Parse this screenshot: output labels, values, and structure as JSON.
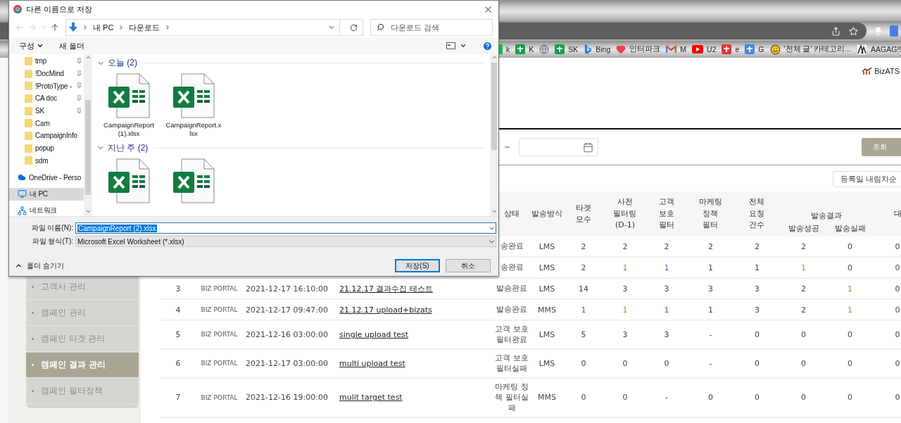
{
  "browser": {
    "bookmarks": [
      {
        "kind": "naver",
        "label": "k"
      },
      {
        "kind": "plus",
        "label": "K"
      },
      {
        "kind": "globe"
      },
      {
        "kind": "plus",
        "label": "SK"
      },
      {
        "kind": "bing",
        "label": "Bing"
      },
      {
        "kind": "heart",
        "label": "인터파크"
      },
      {
        "kind": "mail",
        "label": "M"
      },
      {
        "kind": "video",
        "label": "U2"
      },
      {
        "kind": "red",
        "label": "e"
      },
      {
        "kind": "translate",
        "label": "G"
      },
      {
        "kind": "smile",
        "label": "'전체 글' 카테고리..."
      },
      {
        "kind": "aagag",
        "label": "AAGAG!!"
      }
    ]
  },
  "page": {
    "logo": "BizATS",
    "range_sep": "~",
    "search_button": "조회",
    "sort_button": "등록일 내림차순",
    "sidebar": [
      {
        "label": "고객사 관리",
        "selected": false
      },
      {
        "label": "캠페인 관리",
        "selected": false
      },
      {
        "label": "캠페인 타겟 관리",
        "selected": false
      },
      {
        "label": "캠페인 결과 관리",
        "selected": true
      },
      {
        "label": "캠페인 필터정책",
        "selected": false
      }
    ],
    "table": {
      "columns": [
        {
          "label": "상태"
        },
        {
          "label": "발송방식"
        },
        {
          "label": "타겟 모수"
        },
        {
          "label": "사전 필터링 (D-1)"
        },
        {
          "label": "고객 보호 필터"
        },
        {
          "label": "마케팅 정책 필터"
        },
        {
          "label": "전체 요청 건수"
        },
        {
          "label": "발송결과",
          "children": [
            {
              "label": "발송성공"
            },
            {
              "label": "발송실패"
            }
          ]
        },
        {
          "label": "대"
        }
      ],
      "rows": [
        {
          "status": "송완료",
          "method": "LMS",
          "values": [
            "2",
            "2",
            "2",
            "2",
            "2",
            "2",
            "0",
            "0"
          ]
        },
        {
          "status": "송완료",
          "method": "LMS",
          "values": [
            "2",
            {
              "text": "1",
              "color": "#b8843f"
            },
            {
              "text": "1",
              "color": "#3b6fb0"
            },
            "1",
            "1",
            {
              "text": "1",
              "color": "#b8843f"
            },
            "0",
            "0"
          ]
        },
        {
          "no": "3",
          "channel": "BIZ PORTAL",
          "date": "2021-12-17 16:10:00",
          "title": "21.12.17 결과수집 테스트",
          "status": "발송완료",
          "method": "LMS",
          "values": [
            "14",
            "3",
            "3",
            "3",
            "3",
            "2",
            {
              "text": "1",
              "color": "#b8843f"
            },
            "0"
          ]
        },
        {
          "no": "4",
          "channel": "BIZ PORTAL",
          "date": "2021-12-17 09:47:00",
          "title": "21.12.17 upload+bizats",
          "status": "발송완료",
          "method": "MMS",
          "values": [
            {
              "text": "1",
              "color": "#3b6fb0"
            },
            {
              "text": "1",
              "color": "#b8843f"
            },
            {
              "text": "1",
              "color": "#3b6fb0"
            },
            "1",
            "3",
            "2",
            {
              "text": "1",
              "color": "#b8843f"
            },
            "0"
          ]
        },
        {
          "no": "5",
          "channel": "BIZ PORTAL",
          "date": "2021-12-16 03:00:00",
          "title": "single upload test",
          "status": "고객 보호 필터완료",
          "method": "LMS",
          "values": [
            "5",
            "3",
            "3",
            "-",
            "0",
            "0",
            "0",
            "0"
          ]
        },
        {
          "no": "6",
          "channel": "BIZ PORTAL",
          "date": "2021-12-17 03:00:00",
          "title": "multi upload test",
          "status": "고객 보호 필터실패",
          "method": "LMS",
          "values": [
            "0",
            "0",
            "0",
            "-",
            "0",
            "0",
            "0",
            "0"
          ]
        },
        {
          "no": "7",
          "channel": "BIZ PORTAL",
          "date": "2021-12-16 19:00:00",
          "title": "mulit target test",
          "status": "마케팅 정책 필터실패",
          "method": "MMS",
          "values": [
            "0",
            "0",
            "-",
            "0",
            "0",
            "0",
            "0",
            "0"
          ]
        }
      ]
    }
  },
  "dialog": {
    "title": "다른 이름으로 저장",
    "path": [
      "내 PC",
      "다운로드"
    ],
    "search": {
      "placeholder": "다운로드 검색"
    },
    "organize": "구성",
    "new_folder": "새 폴더",
    "nav_items": [
      {
        "label": "tmp",
        "kind": "folder",
        "pinned": true,
        "selected": false
      },
      {
        "label": "!DocMind",
        "kind": "folder",
        "pinned": true,
        "selected": false
      },
      {
        "label": "!ProtoType -",
        "kind": "folder",
        "pinned": true,
        "selected": false
      },
      {
        "label": "CA doc",
        "kind": "folder",
        "pinned": true,
        "selected": false
      },
      {
        "label": "SK",
        "kind": "folder",
        "pinned": true,
        "selected": false
      },
      {
        "label": "Cam",
        "kind": "folder",
        "pinned": false,
        "selected": false
      },
      {
        "label": "CampaignInfo",
        "kind": "folder",
        "pinned": false,
        "selected": false
      },
      {
        "label": "popup",
        "kind": "folder",
        "pinned": false,
        "selected": false
      },
      {
        "label": "sdm",
        "kind": "folder",
        "pinned": false,
        "selected": false
      },
      {
        "label": "OneDrive - Perso",
        "kind": "cloud",
        "pinned": false,
        "selected": false
      },
      {
        "label": "내 PC",
        "kind": "pc",
        "pinned": false,
        "selected": true
      },
      {
        "label": "네트워크",
        "kind": "network",
        "pinned": false,
        "selected": false
      }
    ],
    "groups": [
      {
        "label": "오늘 (2)",
        "expanded": true,
        "files": [
          {
            "kind": "xlsx",
            "name": "CampaignReport (1).xlsx"
          },
          {
            "kind": "xlsx",
            "name": "CampaignReport.xlsx"
          }
        ]
      },
      {
        "label": "지난 주 (2)",
        "expanded": true,
        "files": [
          {
            "kind": "xlsx"
          },
          {
            "kind": "xlsx"
          }
        ]
      }
    ],
    "filename_label": "파일 이름(N):",
    "filename": "CampaignReport (2).xlsx",
    "filetype_label": "파일 형식(T):",
    "filetype": "Microsoft Excel Worksheet (*.xlsx)",
    "hide_folders": "폴더 숨기기",
    "buttons": [
      {
        "label": "저장(S)",
        "default": true
      },
      {
        "label": "취소",
        "default": false
      }
    ]
  }
}
